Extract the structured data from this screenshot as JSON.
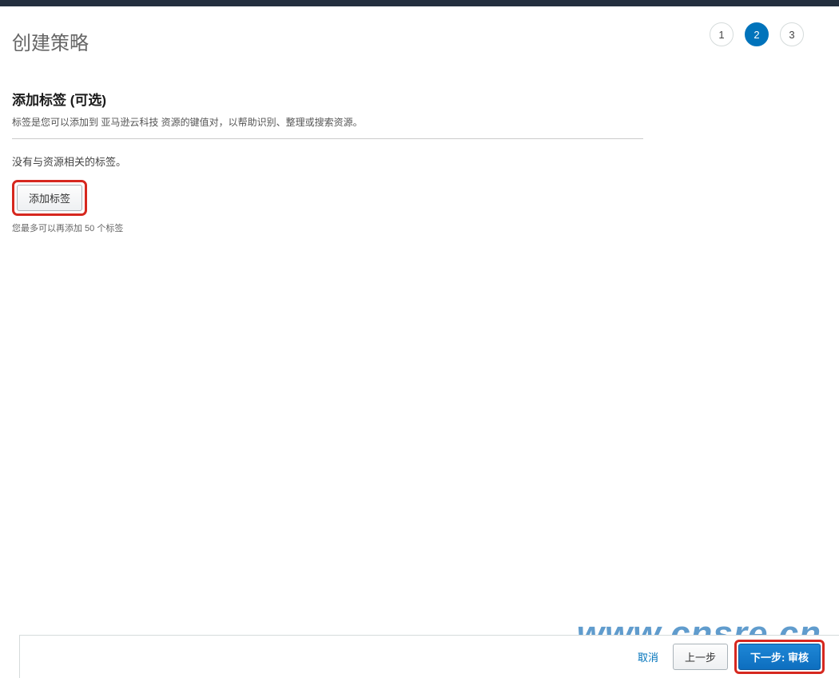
{
  "header": {
    "page_title": "创建策略"
  },
  "stepper": {
    "steps": [
      "1",
      "2",
      "3"
    ],
    "active_index": 1
  },
  "tags_section": {
    "title": "添加标签 (可选)",
    "description": "标签是您可以添加到 亚马逊云科技 资源的键值对，以帮助识别、整理或搜索资源。",
    "no_tags": "没有与资源相关的标签。",
    "add_button": "添加标签",
    "hint": "您最多可以再添加 50 个标签"
  },
  "footer": {
    "cancel": "取消",
    "prev": "上一步",
    "next": "下一步: 审核"
  },
  "watermark": "www.cnsre.cn"
}
